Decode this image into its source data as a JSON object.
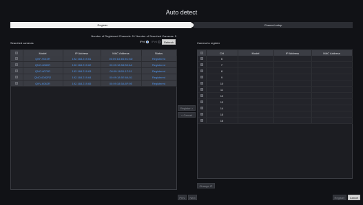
{
  "window": {
    "title": "Auto detect"
  },
  "steps": [
    {
      "label": "Register"
    },
    {
      "label": "Channel setup"
    }
  ],
  "summary": {
    "counts_text": "Number of Registered Channels: 5 / Number of Searched Cameras: 5"
  },
  "searched": {
    "label": "Searched cameras",
    "ipv4_label": "IPv4",
    "ipv6_label": "IPv6",
    "refresh_label": "Refresh",
    "columns": [
      "Model",
      "IP Address",
      "MAC Address",
      "Status"
    ],
    "rows": [
      {
        "model": "QNF-9010R",
        "ip": "192.168.219.61",
        "mac": "00:09:18:4B:3C:8D",
        "status": "Registered"
      },
      {
        "model": "QNO-6082R",
        "ip": "192.168.219.62",
        "mac": "00:09:18:58:B0:6A",
        "status": "Registered"
      },
      {
        "model": "QNO-6070R",
        "ip": "192.168.219.63",
        "mac": "00:09:18:51:1F:51",
        "status": "Registered"
      },
      {
        "model": "QNO-6082R2",
        "ip": "192.168.219.64",
        "mac": "00:09:18:5E:6A:51",
        "status": "Registered"
      },
      {
        "model": "QNV-6082R",
        "ip": "192.168.219.65",
        "mac": "00:09:18:5A:8F:9E",
        "status": "Registered"
      }
    ]
  },
  "middle": {
    "register_label": "Register >",
    "cancel_label": "< Cancel"
  },
  "register_panel": {
    "label": "Camera to register",
    "columns": [
      "CH",
      "Model",
      "IP Address",
      "MAC Address"
    ],
    "channels": [
      "6",
      "7",
      "8",
      "9",
      "10",
      "11",
      "12",
      "13",
      "14",
      "15",
      "16"
    ],
    "change_ip_label": "Change IP"
  },
  "footer": {
    "prev_label": "Prev",
    "next_label": "Next",
    "register_label": "Register",
    "cancel_label": "Cancel"
  }
}
